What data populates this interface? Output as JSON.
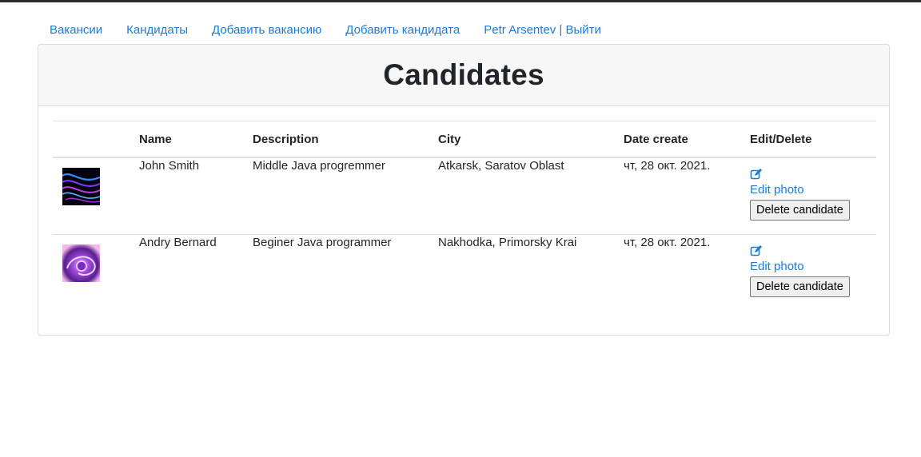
{
  "nav": {
    "vacancies": "Вакансии",
    "candidates": "Кандидаты",
    "add_vacancy": "Добавить вакансию",
    "add_candidate": "Добавить кандидата",
    "user_logout": "Petr Arsentev | Выйти"
  },
  "card": {
    "title": "Candidates"
  },
  "table": {
    "headers": {
      "photo": "",
      "name": "Name",
      "description": "Description",
      "city": "City",
      "date": "Date create",
      "actions": "Edit/Delete"
    },
    "rows": [
      {
        "name": "John Smith",
        "description": "Middle Java progremmer",
        "city": "Atkarsk, Saratov Oblast",
        "date": "чт, 28 окт. 2021.",
        "edit_icon": "edit-icon",
        "edit_photo": "Edit photo",
        "delete": "Delete candidate"
      },
      {
        "name": "Andry Bernard",
        "description": "Beginer Java programmer",
        "city": "Nakhodka, Primorsky Krai",
        "date": "чт, 28 окт. 2021.",
        "edit_icon": "edit-icon",
        "edit_photo": "Edit photo",
        "delete": "Delete candidate"
      }
    ]
  },
  "colors": {
    "link": "#1a7bdc",
    "header_bg": "#f7f7f7",
    "border": "#dee2e6"
  }
}
